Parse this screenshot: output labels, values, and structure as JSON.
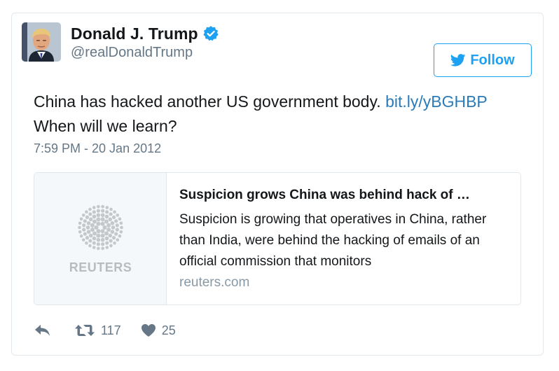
{
  "author": {
    "display_name": "Donald J. Trump",
    "handle": "@realDonaldTrump",
    "verified": true
  },
  "follow_button": {
    "label": "Follow"
  },
  "tweet": {
    "text": "China has hacked another US government body.",
    "link_text": "bit.ly/yBGHBP",
    "text_continued": "When will we learn?",
    "timestamp": "7:59 PM - 20 Jan 2012"
  },
  "link_card": {
    "publisher_logo_text": "REUTERS",
    "title": "Suspicion grows China was behind hack of …",
    "description": "Suspicion is growing that operatives in China, rather than India, were behind the hacking of emails of an official commission that monitors",
    "domain": "reuters.com"
  },
  "actions": {
    "retweet_count": "117",
    "like_count": "25"
  },
  "colors": {
    "link_blue": "#2b7bb9",
    "twitter_blue": "#1da1f2",
    "secondary_gray": "#657786",
    "border": "#e1e8ed"
  }
}
